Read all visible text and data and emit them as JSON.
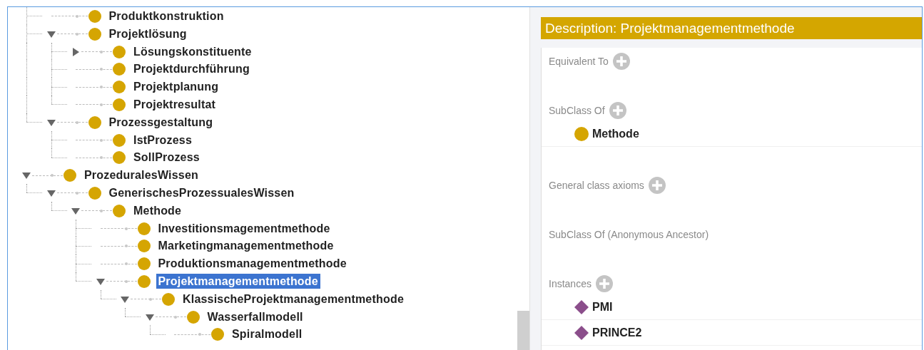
{
  "tree": [
    {
      "children": [
        {
          "label": "Produktkonstruktion",
          "kind": "leaf",
          "selected": false
        },
        {
          "label": "Projektlösung",
          "kind": "branch",
          "expanded": true,
          "selected": false,
          "children": [
            {
              "label": "Lösungskonstituente",
              "kind": "branch",
              "expanded": false,
              "selected": false
            },
            {
              "label": "Projektdurchführung",
              "kind": "leaf",
              "selected": false
            },
            {
              "label": "Projektplanung",
              "kind": "leaf",
              "selected": false
            },
            {
              "label": "Projektresultat",
              "kind": "leaf",
              "selected": false
            }
          ]
        },
        {
          "label": "Prozessgestaltung",
          "kind": "branch",
          "expanded": true,
          "selected": false,
          "children": [
            {
              "label": "IstProzess",
              "kind": "leaf",
              "selected": false
            },
            {
              "label": "SollProzess",
              "kind": "leaf",
              "selected": false
            }
          ]
        }
      ]
    },
    {
      "label": "ProzeduralesWissen",
      "kind": "branch",
      "expanded": true,
      "selected": false,
      "children": [
        {
          "label": "GenerischesProzessualesWissen",
          "kind": "branch",
          "expanded": true,
          "selected": false,
          "children": [
            {
              "label": "Methode",
              "kind": "branch",
              "expanded": true,
              "selected": false,
              "children": [
                {
                  "label": "Investitionsmagementmethode",
                  "kind": "leaf",
                  "selected": false
                },
                {
                  "label": "Marketingmanagementmethode",
                  "kind": "leaf",
                  "selected": false
                },
                {
                  "label": "Produktionsmanagementmethode",
                  "kind": "leaf",
                  "selected": false
                },
                {
                  "label": "Projektmanagementmethode",
                  "kind": "branch",
                  "expanded": true,
                  "selected": true,
                  "children": [
                    {
                      "label": "KlassischeProjektmanagementmethode",
                      "kind": "branch",
                      "expanded": true,
                      "selected": false,
                      "children": [
                        {
                          "label": "Wasserfallmodell",
                          "kind": "branch",
                          "expanded": true,
                          "selected": false,
                          "children": [
                            {
                              "label": "Spiralmodell",
                              "kind": "leaf",
                              "selected": false
                            }
                          ]
                        }
                      ]
                    }
                  ]
                }
              ]
            }
          ]
        }
      ]
    }
  ],
  "description": {
    "title": "Description: Projektmanagementmethode",
    "sections": [
      {
        "label": "Equivalent To",
        "addable": true
      },
      {
        "label": "SubClass Of",
        "addable": true,
        "items": [
          {
            "kind": "class",
            "label": "Methode"
          }
        ]
      },
      {
        "label": "General class axioms",
        "addable": true
      },
      {
        "label": "SubClass Of (Anonymous Ancestor)",
        "addable": false
      },
      {
        "label": "Instances",
        "addable": true,
        "items": [
          {
            "kind": "individual",
            "label": "PMI"
          },
          {
            "kind": "individual",
            "label": "PRINCE2"
          }
        ]
      }
    ]
  }
}
